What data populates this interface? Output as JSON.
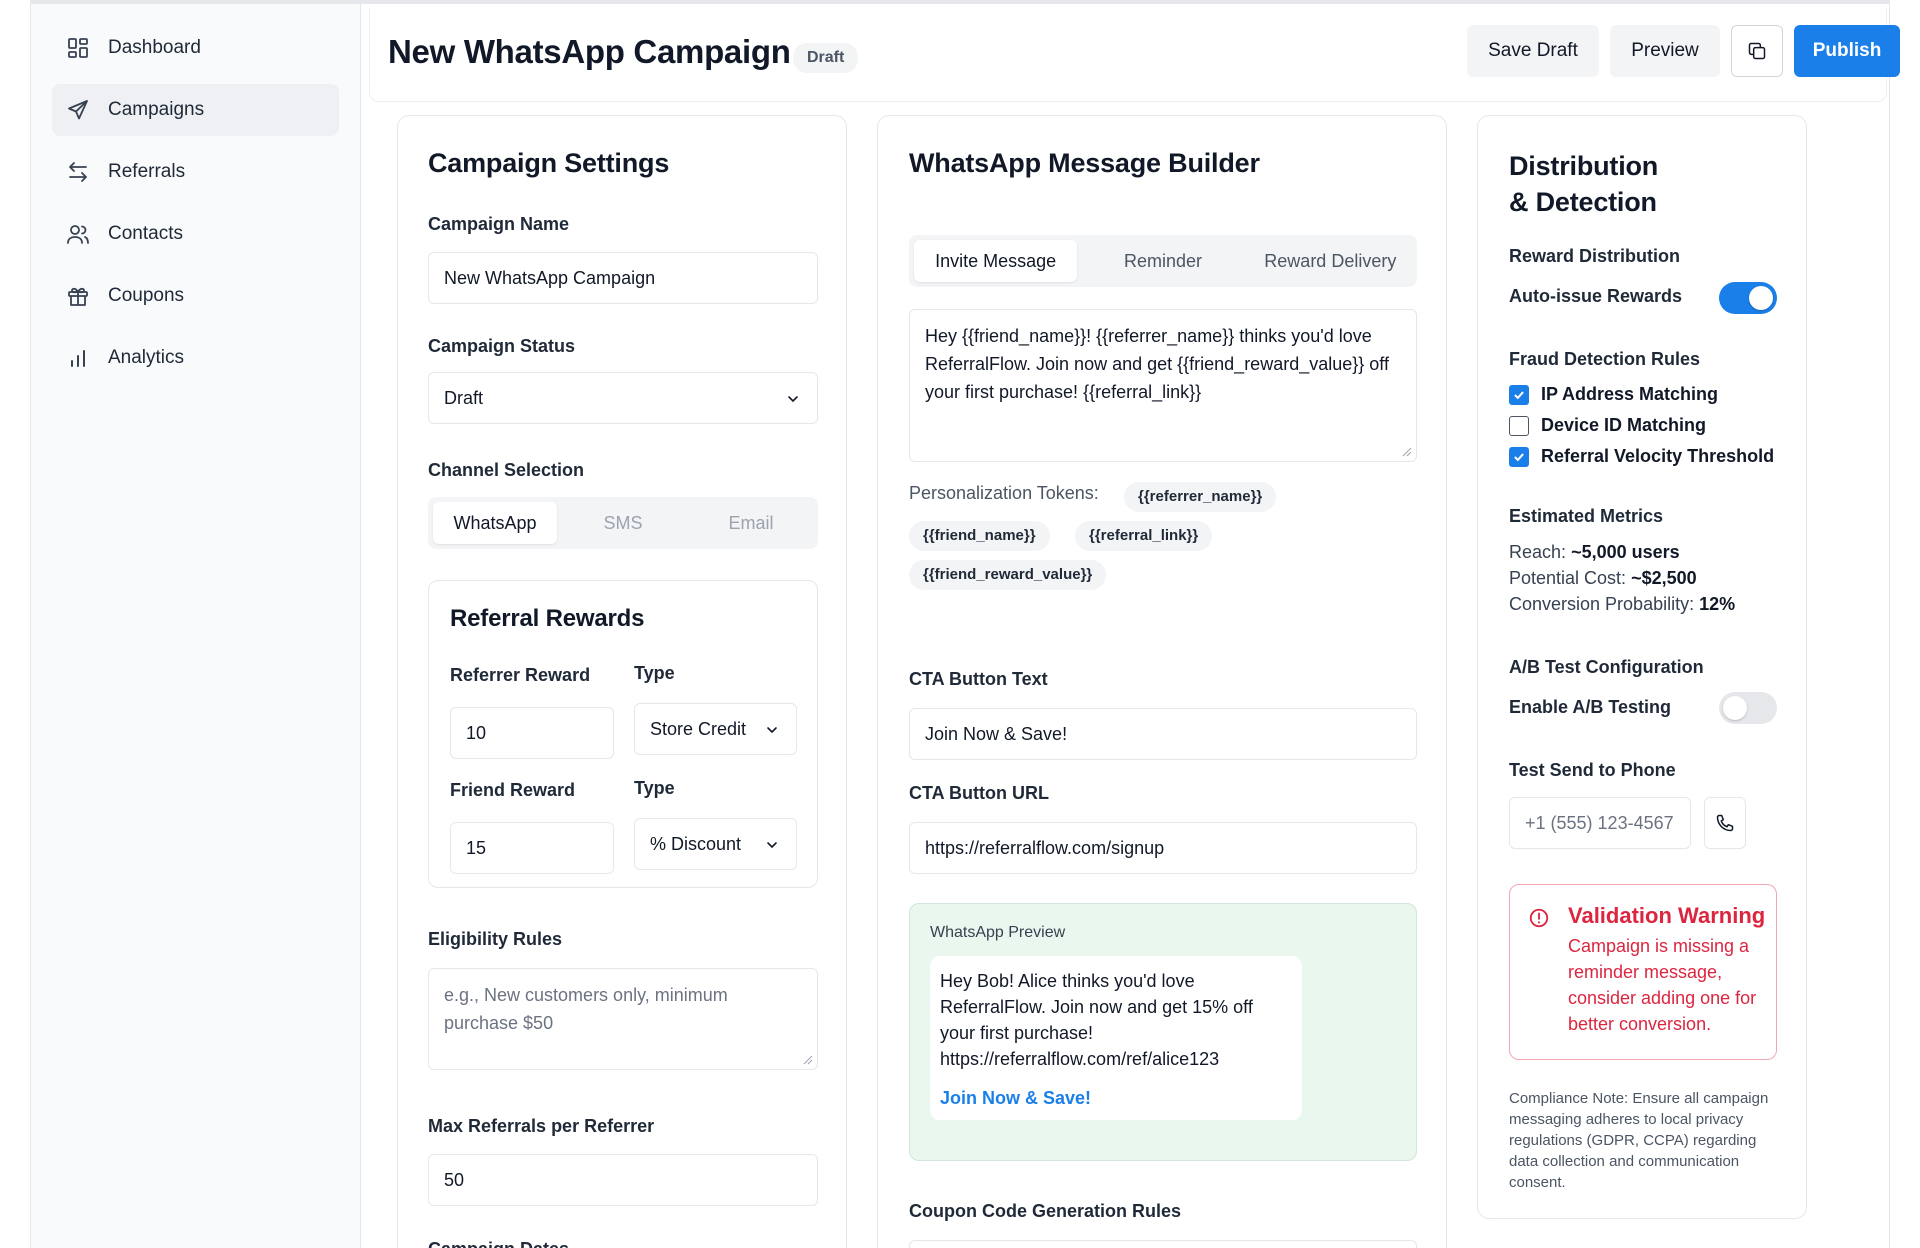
{
  "sidebar": {
    "items": [
      {
        "label": "Dashboard",
        "icon": "dashboard-icon"
      },
      {
        "label": "Campaigns",
        "icon": "send-icon"
      },
      {
        "label": "Referrals",
        "icon": "arrows-exchange-icon"
      },
      {
        "label": "Contacts",
        "icon": "users-icon"
      },
      {
        "label": "Coupons",
        "icon": "gift-icon"
      },
      {
        "label": "Analytics",
        "icon": "bar-chart-icon"
      }
    ],
    "active_index": 1
  },
  "header": {
    "title": "New WhatsApp Campaign",
    "badge": "Draft",
    "save_draft_label": "Save Draft",
    "preview_label": "Preview",
    "publish_label": "Publish",
    "accent_color": "#1a7fe8"
  },
  "settings": {
    "title": "Campaign Settings",
    "campaign_name_label": "Campaign Name",
    "campaign_name_value": "New WhatsApp Campaign",
    "status_label": "Campaign Status",
    "status_value": "Draft",
    "channel_label": "Channel Selection",
    "channels": [
      "WhatsApp",
      "SMS",
      "Email"
    ],
    "channel_selected": "WhatsApp",
    "rewards": {
      "title": "Referral Rewards",
      "referrer_label": "Referrer Reward",
      "referrer_value": "10",
      "type_label": "Type",
      "referrer_type": "Store Credit",
      "friend_label": "Friend Reward",
      "friend_value": "15",
      "friend_type": "% Discount"
    },
    "eligibility_label": "Eligibility Rules",
    "eligibility_placeholder": "e.g., New customers only, minimum purchase $50",
    "max_referrals_label": "Max Referrals per Referrer",
    "max_referrals_value": "50",
    "dates_label": "Campaign Dates"
  },
  "builder": {
    "title": "WhatsApp Message Builder",
    "tabs": [
      "Invite Message",
      "Reminder",
      "Reward Delivery"
    ],
    "active_tab": "Invite Message",
    "message": "Hey {{friend_name}}! {{referrer_name}} thinks you'd love ReferralFlow. Join now and get {{friend_reward_value}} off your first purchase! {{referral_link}}",
    "tokens_label": "Personalization Tokens:",
    "tokens": [
      "{{referrer_name}}",
      "{{friend_name}}",
      "{{referral_link}}",
      "{{friend_reward_value}}"
    ],
    "cta_text_label": "CTA Button Text",
    "cta_text_value": "Join Now & Save!",
    "cta_url_label": "CTA Button URL",
    "cta_url_value": "https://referralflow.com/signup",
    "preview": {
      "label": "WhatsApp Preview",
      "line1": "Hey Bob! Alice thinks you'd love",
      "line2": "ReferralFlow. Join now and get 15% off",
      "line3": "your first purchase!",
      "line4": "https://referralflow.com/ref/alice123",
      "cta": "Join Now & Save!",
      "bg_color": "#eaf7ee"
    },
    "coupon_rules_label": "Coupon Code Generation Rules"
  },
  "distribution": {
    "title_line1": "Distribution",
    "title_line2": "& Detection",
    "reward_dist_label": "Reward Distribution",
    "auto_issue_label": "Auto-issue Rewards",
    "auto_issue_on": true,
    "fraud_label": "Fraud Detection Rules",
    "fraud_rules": [
      {
        "label": "IP Address Matching",
        "checked": true
      },
      {
        "label": "Device ID Matching",
        "checked": false
      },
      {
        "label": "Referral Velocity Threshold",
        "checked": true
      }
    ],
    "metrics_label": "Estimated Metrics",
    "reach_label": "Reach:",
    "reach_value": "~5,000 users",
    "cost_label": "Potential Cost:",
    "cost_value": "~$2,500",
    "conversion_label": "Conversion Probability:",
    "conversion_value": "12%",
    "ab_label": "A/B Test Configuration",
    "ab_toggle_label": "Enable A/B Testing",
    "ab_on": false,
    "test_send_label": "Test Send to Phone",
    "phone_placeholder": "+1 (555) 123-4567",
    "warning_title": "Validation Warning",
    "warning_body": "Campaign is missing a reminder message, consider adding one for better conversion.",
    "warning_color": "#dc2640",
    "compliance": "Compliance Note: Ensure all campaign messaging adheres to local privacy regulations (GDPR, CCPA) regarding data collection and communication consent."
  }
}
